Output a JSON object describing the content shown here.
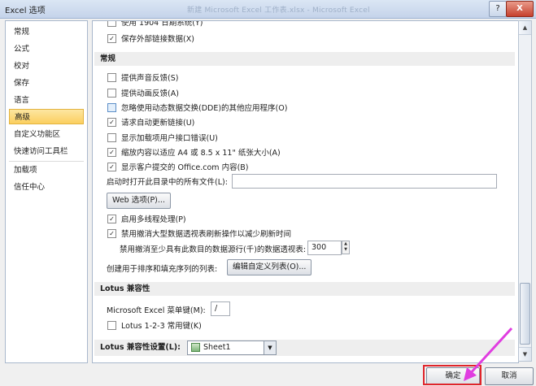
{
  "window": {
    "title": "Excel 选项",
    "background_title": "新建 Microsoft Excel 工作表.xlsx - Microsoft Excel",
    "help_label": "?",
    "close_label": "X"
  },
  "sidebar": {
    "items": [
      {
        "label": "常规"
      },
      {
        "label": "公式"
      },
      {
        "label": "校对"
      },
      {
        "label": "保存"
      },
      {
        "label": "语言"
      },
      {
        "label": "高级",
        "selected": true
      },
      {
        "label": "自定义功能区"
      },
      {
        "label": "快速访问工具栏"
      },
      {
        "label": "加载项"
      },
      {
        "label": "信任中心"
      }
    ]
  },
  "content": {
    "top": {
      "cut_label": "使用 1904 日期系统(Y)",
      "save_links": {
        "label": "保存外部链接数据(X)",
        "checked": true
      }
    },
    "general": {
      "header": "常规",
      "options": [
        {
          "label": "提供声音反馈(S)",
          "checked": false
        },
        {
          "label": "提供动画反馈(A)",
          "checked": false
        },
        {
          "label": "忽略使用动态数据交换(DDE)的其他应用程序(O)",
          "checked": false
        },
        {
          "label": "请求自动更新链接(U)",
          "checked": true
        },
        {
          "label": "显示加载项用户接口错误(U)",
          "checked": false
        },
        {
          "label": "缩放内容以适应 A4 或 8.5 x 11\" 纸张大小(A)",
          "checked": true
        },
        {
          "label": "显示客户提交的 Office.com 内容(B)",
          "checked": true
        }
      ],
      "startup_label": "启动时打开此目录中的所有文件(L):",
      "startup_value": "",
      "web_options_button": "Web 选项(P)...",
      "multithread": {
        "label": "启用多线程处理(P)",
        "checked": true
      },
      "disable_undo": {
        "label": "禁用撤消大型数据透视表刷新操作以减少刷新时间",
        "checked": true
      },
      "undo_rows_label": "禁用撤消至少具有此数目的数据源行(千)的数据透视表:",
      "undo_rows_value": "300",
      "custom_lists_label": "创建用于排序和填充序列的列表:",
      "custom_lists_button": "编辑自定义列表(O)..."
    },
    "lotus": {
      "header": "Lotus 兼容性",
      "menu_key_label": "Microsoft Excel 菜单键(M):",
      "menu_key_value": "/",
      "nav_keys": {
        "label": "Lotus 1-2-3 常用键(K)",
        "checked": false
      }
    },
    "lotus_settings": {
      "label": "Lotus 兼容性设置(L):",
      "sheet_value": "Sheet1"
    }
  },
  "footer": {
    "ok_label": "确定",
    "cancel_label": "取消"
  },
  "colors": {
    "selected_nav": "#fbcf5f",
    "highlight_box": "#e0252b",
    "annotation_arrow": "#e03de0"
  }
}
